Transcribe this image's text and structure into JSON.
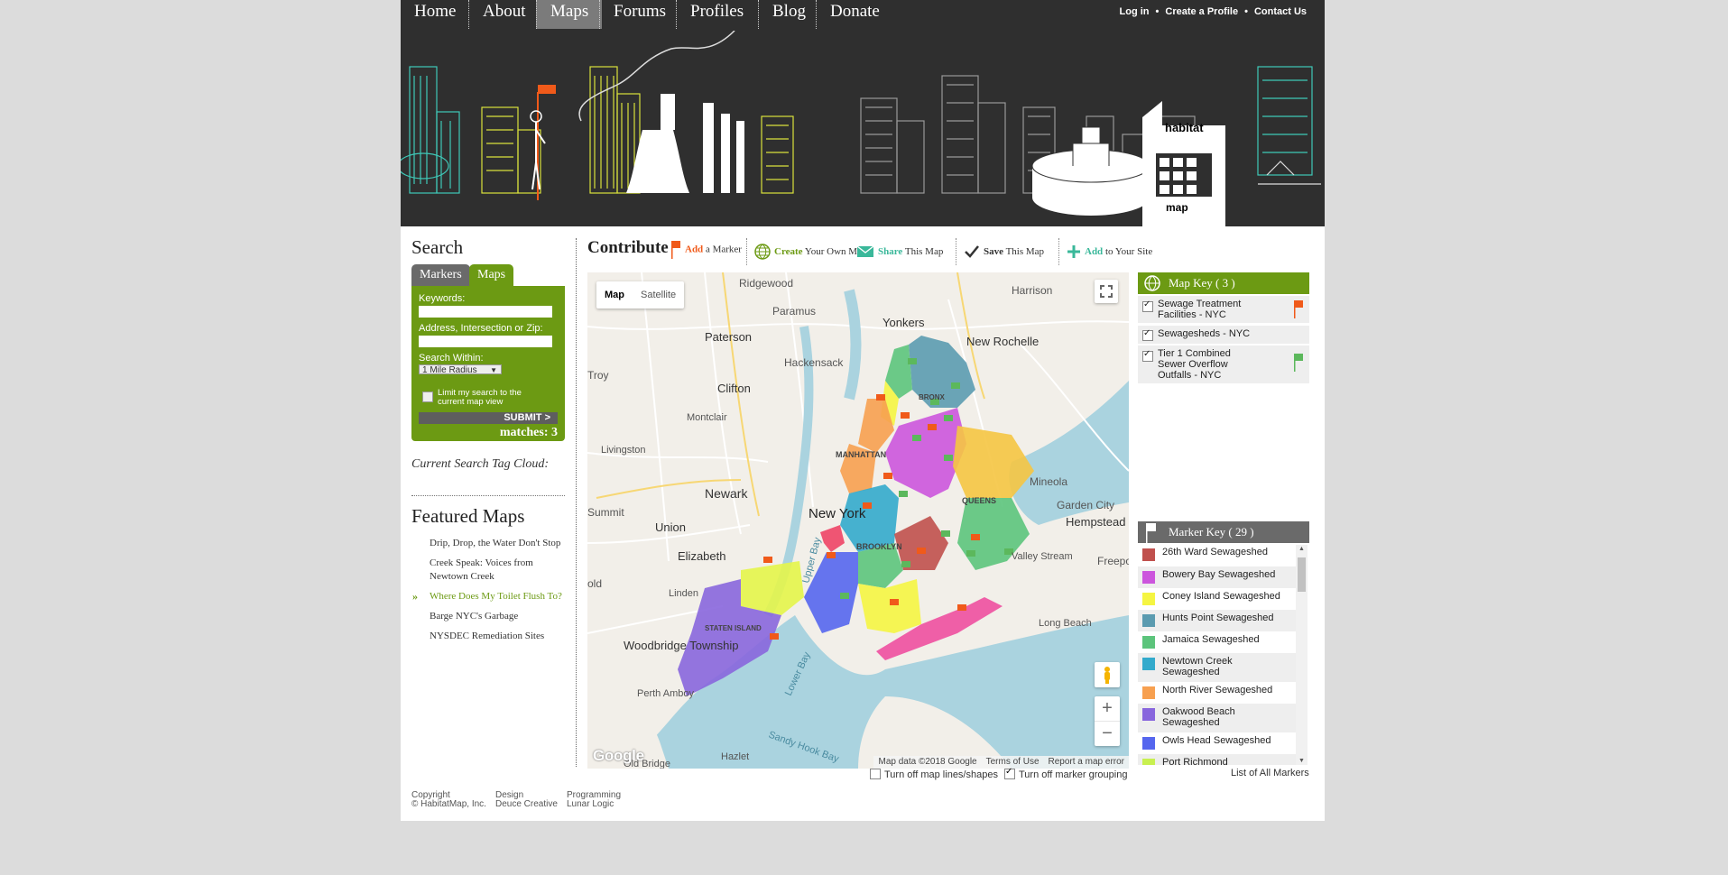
{
  "nav": {
    "items": [
      "Home",
      "About",
      "Maps",
      "Forums",
      "Profiles",
      "Blog",
      "Donate"
    ],
    "active": "Maps",
    "login": "Log in",
    "create_profile": "Create a Profile",
    "contact": "Contact Us",
    "separator": "•"
  },
  "banner": {
    "logo_top": "habitat",
    "logo_bottom": "map"
  },
  "search": {
    "title": "Search",
    "tab_markers": "Markers",
    "tab_maps": "Maps",
    "keywords_label": "Keywords:",
    "address_label": "Address, Intersection or Zip:",
    "within_label": "Search Within:",
    "within_value": "1 Mile Radius",
    "limit_label": "Limit my search to the current map view",
    "submit": "SUBMIT >",
    "matches": "matches: 3",
    "tag_cloud": "Current Search Tag Cloud:"
  },
  "featured": {
    "title": "Featured Maps",
    "items": [
      "Drip, Drop, the Water Don't Stop",
      "Creek Speak: Voices from Newtown Creek",
      "Where Does My Toilet Flush To?",
      "Barge NYC's Garbage",
      "NYSDEC Remediation Sites"
    ],
    "active_index": 2
  },
  "contribute": {
    "title": "Contribute",
    "add_b": "Add",
    "add_rest": "a Marker",
    "create_b": "Create",
    "create_rest": "Your Own Map",
    "share_b": "Share",
    "share_rest": "This Map",
    "save_b": "Save",
    "save_rest": "This Map",
    "addsite_b": "Add",
    "addsite_rest": "to Your Site"
  },
  "map": {
    "type_map": "Map",
    "type_satellite": "Satellite",
    "attribution_data": "Map data ©2018 Google",
    "terms": "Terms of Use",
    "report": "Report a map error",
    "google": "Google",
    "zoom_in": "+",
    "zoom_out": "−",
    "labels": {
      "ridgewood": "Ridgewood",
      "harrison": "Harrison",
      "paramus": "Paramus",
      "yonkers": "Yonkers",
      "new_rochelle": "New Rochelle",
      "paterson": "Paterson",
      "hackensack": "Hackensack",
      "troy": "Troy",
      "clifton": "Clifton",
      "montclair": "Montclair",
      "livingston": "Livingston",
      "newark": "Newark",
      "summit": "Summit",
      "union": "Union",
      "new_york": "New York",
      "elizabeth": "Elizabeth",
      "linden": "Linden",
      "mineola": "Mineola",
      "garden_city": "Garden City",
      "hempstead": "Hempstead",
      "woodbridge": "Woodbridge Township",
      "perth_amboy": "Perth Amboy",
      "long_beach": "Long Beach",
      "hazlet": "Hazlet",
      "manhattan": "MANHATTAN",
      "brooklyn": "BROOKLYN",
      "queens": "QUEENS",
      "bronx": "BRONX",
      "staten_island": "STATEN ISLAND",
      "lower_bay": "Lower Bay",
      "upper_bay": "Upper Bay",
      "sandy_hook_bay": "Sandy Hook Bay",
      "valley_stream": "Valley Stream",
      "freepo": "Freepo",
      "old": "old",
      "old_bridge": "Old Bridge"
    }
  },
  "map_key": {
    "title": "Map Key ( 3 )",
    "items": [
      {
        "label": "Sewage Treatment Facilities - NYC",
        "flag": "#f05a1a"
      },
      {
        "label": "Sewagesheds - NYC",
        "flag": ""
      },
      {
        "label": "Tier 1 Combined Sewer Overflow Outfalls - NYC",
        "flag": "#5cb85c"
      }
    ]
  },
  "marker_key": {
    "title": "Marker Key ( 29 )",
    "items": [
      {
        "label": "26th Ward Sewageshed",
        "color": "#c0504d"
      },
      {
        "label": "Bowery Bay Sewageshed",
        "color": "#cc55dd"
      },
      {
        "label": "Coney Island Sewageshed",
        "color": "#f5f542"
      },
      {
        "label": "Hunts Point Sewageshed",
        "color": "#5b9bb0"
      },
      {
        "label": "Jamaica Sewageshed",
        "color": "#5cc47c"
      },
      {
        "label": "Newtown Creek Sewageshed",
        "color": "#33aacc"
      },
      {
        "label": "North River Sewageshed",
        "color": "#f7a050"
      },
      {
        "label": "Oakwood Beach Sewageshed",
        "color": "#8866dd"
      },
      {
        "label": "Owls Head Sewageshed",
        "color": "#5566ee"
      },
      {
        "label": "Port Richmond",
        "color": "#c8f050"
      }
    ],
    "list_all": "List of All Markers"
  },
  "map_options": {
    "lines_off": "Turn off map lines/shapes",
    "grouping_off": "Turn off marker grouping"
  },
  "footer": {
    "copyright_h": "Copyright",
    "copyright_v": "© HabitatMap, Inc.",
    "design_h": "Design",
    "design_v": "Deuce Creative",
    "programming_h": "Programming",
    "programming_v": "Lunar Logic"
  }
}
